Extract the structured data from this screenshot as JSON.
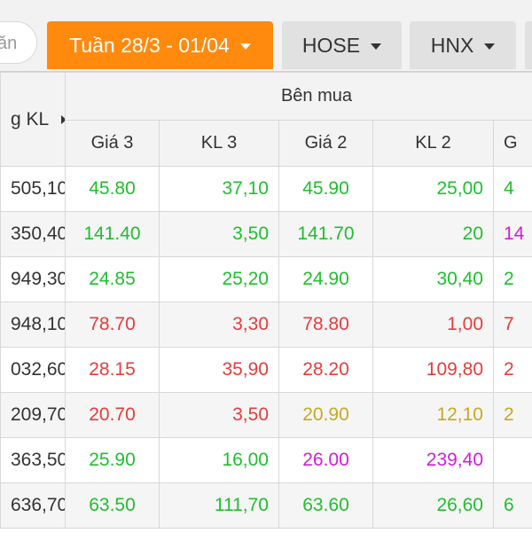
{
  "toolbar": {
    "search_text": "ăn",
    "week_tab": "Tuần 28/3 - 01/04",
    "exchange_tabs": [
      "HOSE",
      "HNX"
    ]
  },
  "header": {
    "total_volume_label": "g KL",
    "buy_side_label": "Bên mua",
    "columns": [
      "Giá 3",
      "KL 3",
      "Giá 2",
      "KL 2",
      "G"
    ]
  },
  "colors": {
    "accent": "#ff8a0d",
    "up": "#1fbf2e",
    "down": "#e83b3b",
    "reference": "#c9a823",
    "ceiling": "#d21cd8"
  },
  "rows": [
    {
      "total": "505,10",
      "gia3": "45.80",
      "kl3": "37,10",
      "gia2": "45.90",
      "kl2": "25,00",
      "next": "4",
      "c3": "green",
      "c2": "green",
      "cn": "green"
    },
    {
      "total": "350,40",
      "gia3": "141.40",
      "kl3": "3,50",
      "gia2": "141.70",
      "kl2": "20",
      "next": "14",
      "c3": "green",
      "c2": "green",
      "cn": "purple"
    },
    {
      "total": "949,30",
      "gia3": "24.85",
      "kl3": "25,20",
      "gia2": "24.90",
      "kl2": "30,40",
      "next": "2",
      "c3": "green",
      "c2": "green",
      "cn": "green"
    },
    {
      "total": "948,10",
      "gia3": "78.70",
      "kl3": "3,30",
      "gia2": "78.80",
      "kl2": "1,00",
      "next": "7",
      "c3": "red",
      "c2": "red",
      "cn": "red"
    },
    {
      "total": "032,60",
      "gia3": "28.15",
      "kl3": "35,90",
      "gia2": "28.20",
      "kl2": "109,80",
      "next": "2",
      "c3": "red",
      "c2": "red",
      "cn": "red"
    },
    {
      "total": "209,70",
      "gia3": "20.70",
      "kl3": "3,50",
      "gia2": "20.90",
      "kl2": "12,10",
      "next": "2",
      "c3": "red",
      "c2": "yellow",
      "cn": "yellow"
    },
    {
      "total": "363,50",
      "gia3": "25.90",
      "kl3": "16,00",
      "gia2": "26.00",
      "kl2": "239,40",
      "next": "",
      "c3": "green",
      "c2": "purple",
      "cn": "neutral"
    },
    {
      "total": "636,70",
      "gia3": "63.50",
      "kl3": "111,70",
      "gia2": "63.60",
      "kl2": "26,60",
      "next": "6",
      "c3": "green",
      "c2": "green",
      "cn": "green"
    }
  ]
}
